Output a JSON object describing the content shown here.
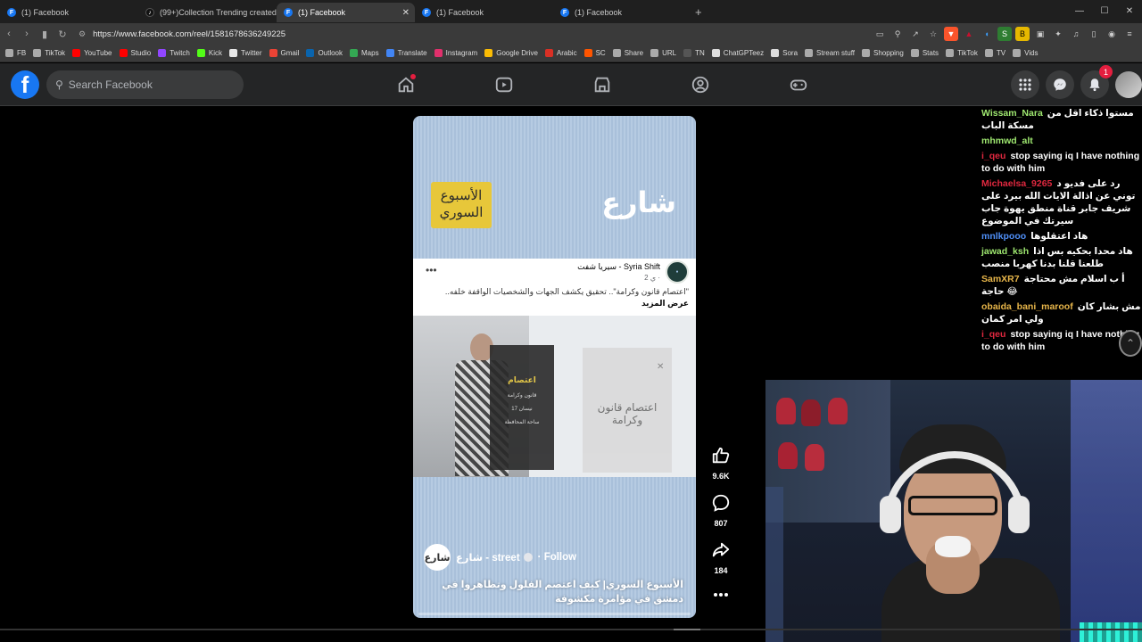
{
  "browser": {
    "tabs": [
      {
        "title": "(1) Facebook",
        "favicon": "F",
        "type": "fb"
      },
      {
        "title": "(99+)Collection Trending created by",
        "favicon": "♪",
        "type": "tt"
      },
      {
        "title": "(1) Facebook",
        "favicon": "F",
        "type": "fb",
        "active": true
      },
      {
        "title": "(1) Facebook",
        "favicon": "F",
        "type": "fb"
      },
      {
        "title": "(1) Facebook",
        "favicon": "F",
        "type": "fb"
      }
    ],
    "url": "https://www.facebook.com/reel/1581678636249225",
    "bookmarks": [
      {
        "label": "FB",
        "color": "#aaaaaa"
      },
      {
        "label": "TikTok",
        "color": "#aaaaaa"
      },
      {
        "label": "YouTube",
        "color": "#ff0000"
      },
      {
        "label": "Studio",
        "color": "#ff0000"
      },
      {
        "label": "Twitch",
        "color": "#9146ff"
      },
      {
        "label": "Kick",
        "color": "#53fc18"
      },
      {
        "label": "Twitter",
        "color": "#e7e7e7"
      },
      {
        "label": "Gmail",
        "color": "#ea4335"
      },
      {
        "label": "Outlook",
        "color": "#0a64ad"
      },
      {
        "label": "Maps",
        "color": "#34a853"
      },
      {
        "label": "Translate",
        "color": "#4285f4"
      },
      {
        "label": "Instagram",
        "color": "#e1306c"
      },
      {
        "label": "Google Drive",
        "color": "#fbbc04"
      },
      {
        "label": "Arabic",
        "color": "#d93025"
      },
      {
        "label": "SC",
        "color": "#ff5500"
      },
      {
        "label": "Share",
        "color": "#aaaaaa"
      },
      {
        "label": "URL",
        "color": "#aaaaaa"
      },
      {
        "label": "TN",
        "color": "#555555"
      },
      {
        "label": "ChatGPTeez",
        "color": "#dddddd"
      },
      {
        "label": "Sora",
        "color": "#dddddd"
      },
      {
        "label": "Stream stuff",
        "color": "#aaaaaa"
      },
      {
        "label": "Shopping",
        "color": "#aaaaaa"
      },
      {
        "label": "Stats",
        "color": "#aaaaaa"
      },
      {
        "label": "TikTok",
        "color": "#aaaaaa"
      },
      {
        "label": "TV",
        "color": "#aaaaaa"
      },
      {
        "label": "Vids",
        "color": "#aaaaaa"
      }
    ]
  },
  "facebook": {
    "search_placeholder": "Search Facebook",
    "notification_count": "1",
    "brand_color": "#1877f2"
  },
  "reel": {
    "yellow_card_text": "الأسبوع السوري",
    "logo_text": "شارع",
    "post": {
      "page_name": "سيريا شفت - Syria Shift",
      "meta": "2 ي · ",
      "text": "\"اعتصام قانون وكرامة\".. تحقيق يكشف الجهات والشخصيات الواقفة خلفه..",
      "see_more": "عرض المزيد",
      "poster_title": "اعتصام",
      "poster_lines": [
        "قانون وكرامة",
        "17 نيسان",
        "ساحة المحافظة"
      ],
      "poster2_text": "اعتصام قانون وكرامة"
    },
    "channel": {
      "avatar_text": "شارع",
      "name": "شارع - street",
      "follow": "Follow"
    },
    "caption": "الأسبوع السوري| كيف اعتصم الفلول وتظاهروا في دمشق في مؤامرة مكشوفة",
    "progress": 0.0
  },
  "actions": {
    "likes": "9.6K",
    "comments": "807",
    "shares": "184"
  },
  "chat": [
    {
      "user": "Wissam_Nara",
      "color": "#9fe870",
      "text": "مستوا ذكاء اقل من مسكة الباب"
    },
    {
      "user": "mhmwd_alt",
      "color": "#9fe870",
      "text": ""
    },
    {
      "user": "i_qeu",
      "color": "#e0283f",
      "text": "stop saying iq I have nothing to do with him"
    },
    {
      "user": "Michaelsa_9265",
      "color": "#e0283f",
      "text": "رد على فديو د توني عن اذالة الايات الله بيرد على شريف جابر قناة منطق يهوة جاب سيرتك في الموضوع"
    },
    {
      "user": "mnlkpooo",
      "color": "#4f8ff7",
      "text": "هاد اعتقلوها"
    },
    {
      "user": "jawad_ksh",
      "color": "#9fe870",
      "text": "هاد محدا بحكيه بس اذا طلعنا قلنا بدنا كهربا منصب"
    },
    {
      "user": "SamXR7",
      "color": "#e8b64a",
      "text": "أ ب اسلام مش محتاجة حاجة 😂"
    },
    {
      "user": "obaida_bani_maroof",
      "color": "#e8b64a",
      "text": "مش بشار كان ولي امر كمان"
    },
    {
      "user": "i_qeu",
      "color": "#e0283f",
      "text": "stop saying iq I have nothing to do with him"
    }
  ]
}
